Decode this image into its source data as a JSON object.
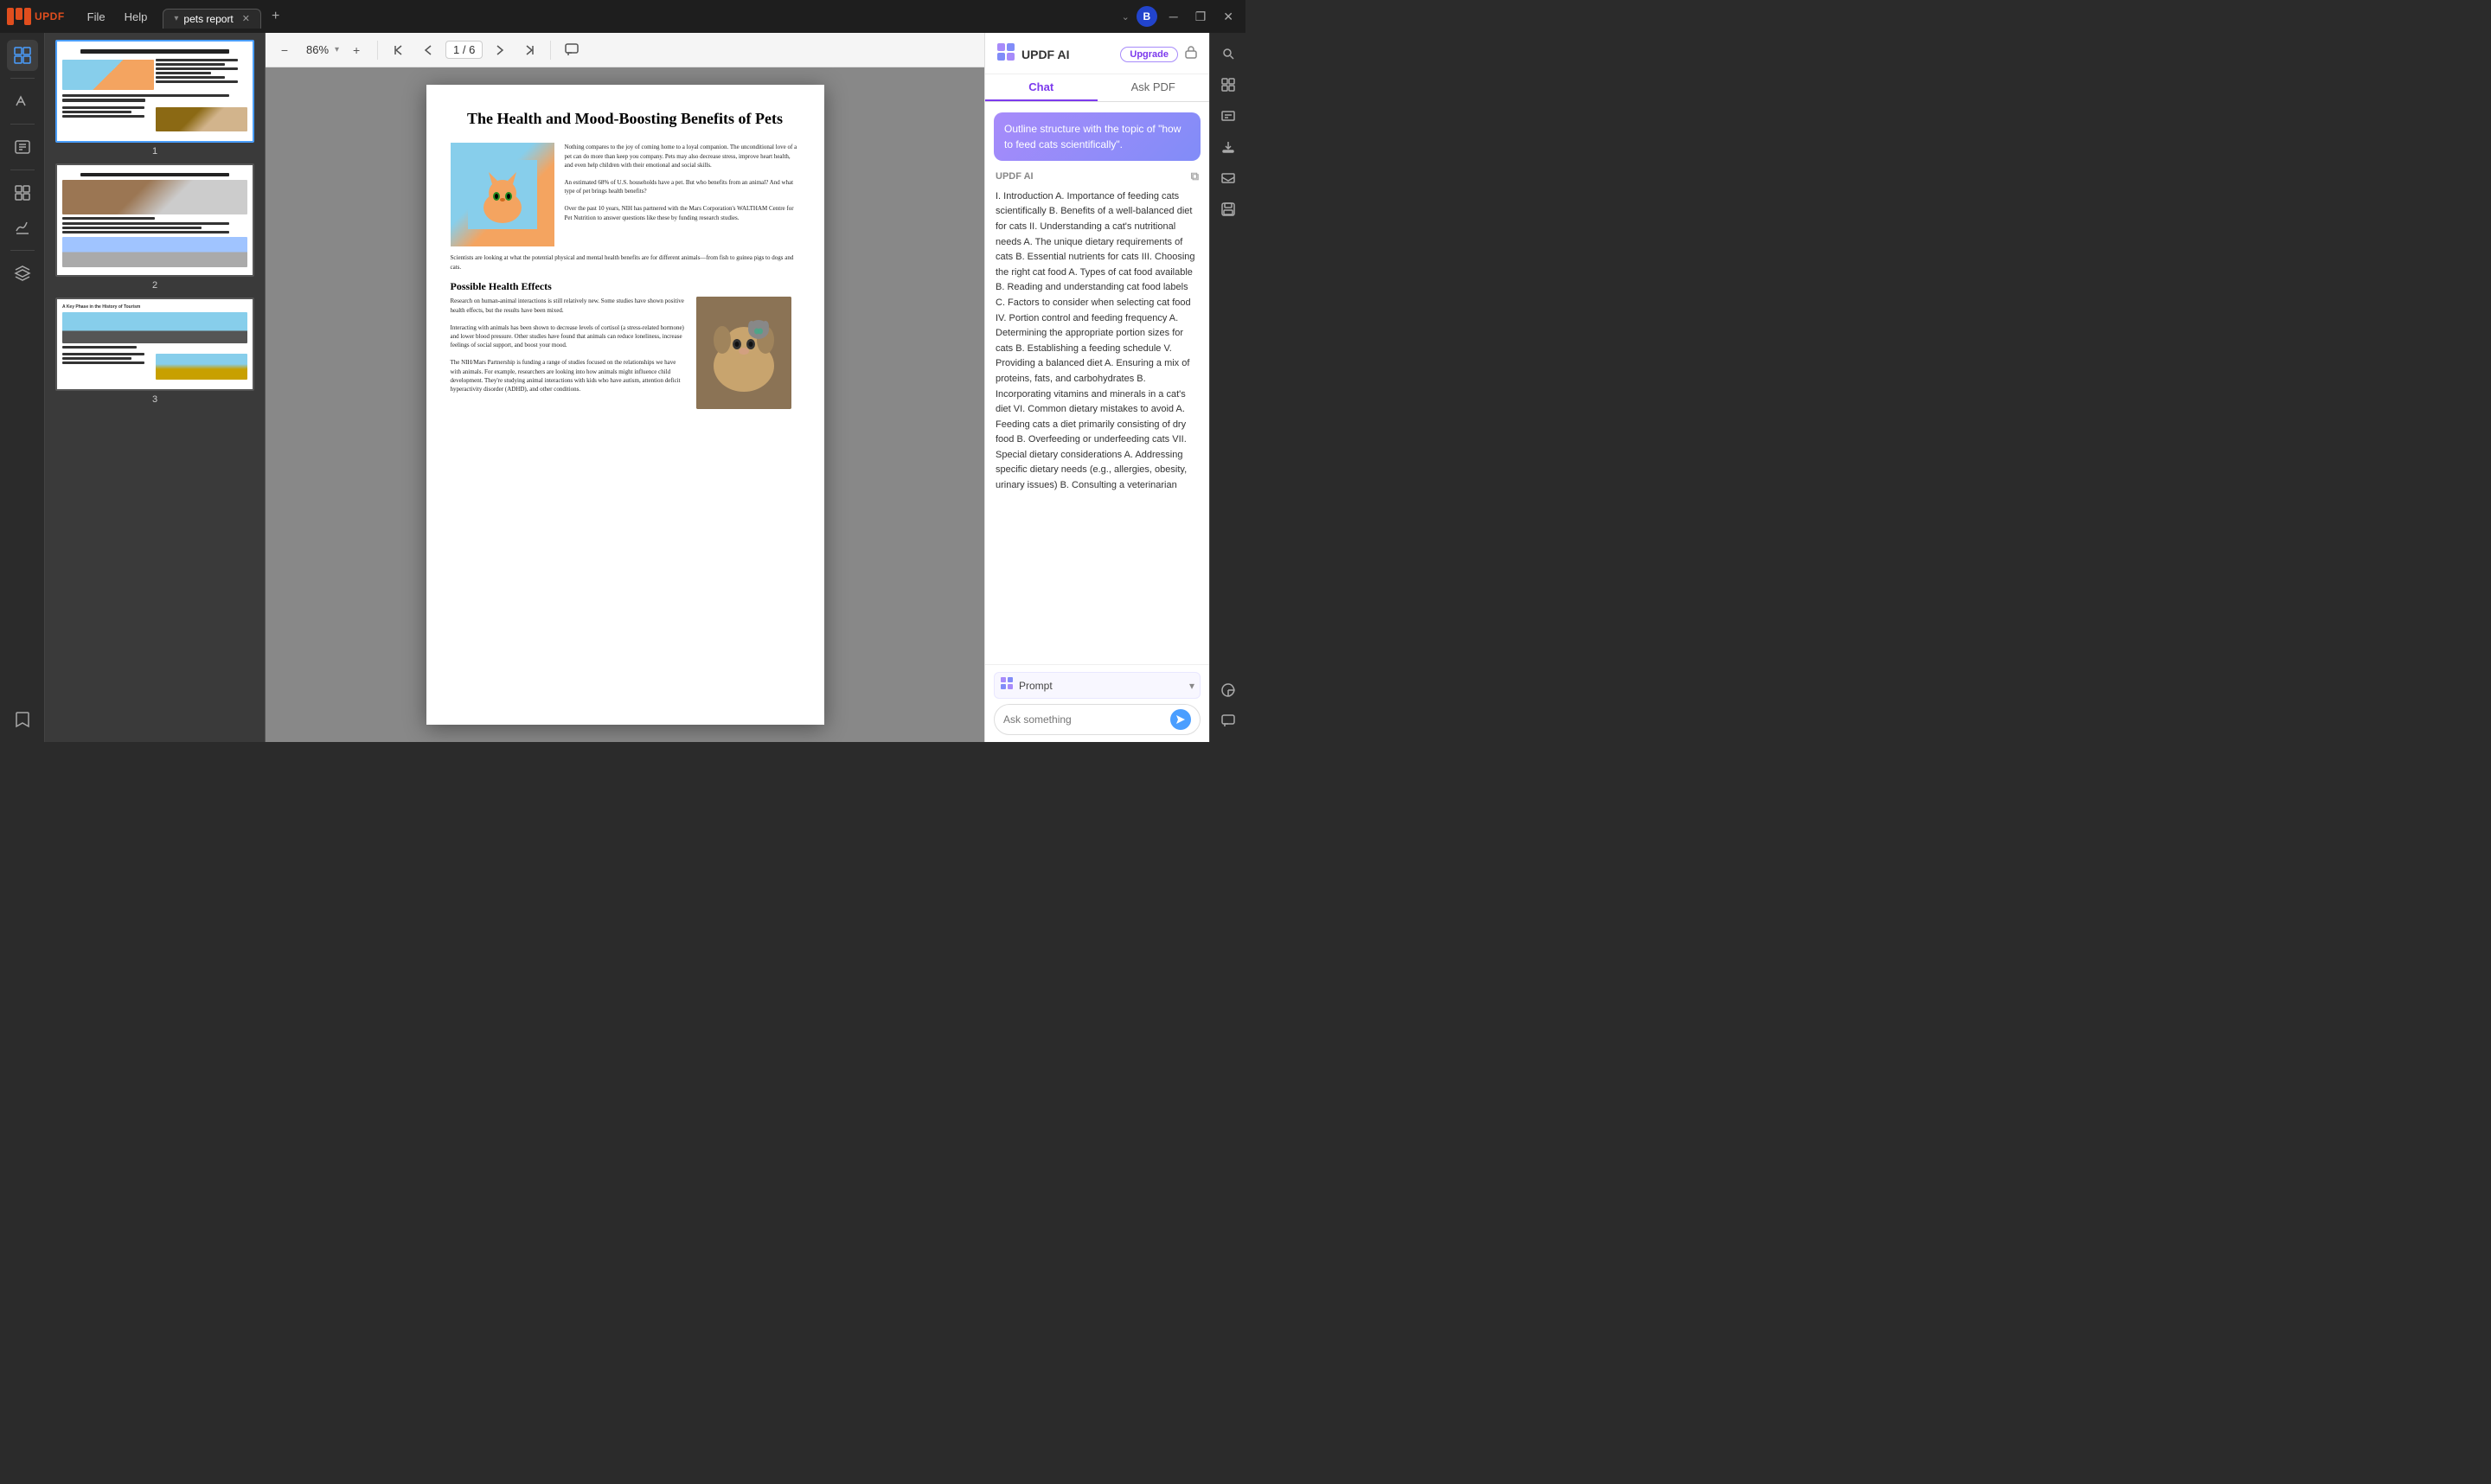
{
  "titleBar": {
    "logoText": "UPDF",
    "menuItems": [
      "File",
      "Help"
    ],
    "tab": {
      "label": "pets report",
      "chevron": "▾"
    },
    "addTab": "+",
    "windowActions": {
      "chevronDown": "⌄",
      "minimize": "─",
      "maximize": "❐",
      "close": "✕"
    },
    "avatar": "B"
  },
  "toolbar": {
    "zoomOut": "−",
    "zoomLevel": "86%",
    "zoomChevron": "▾",
    "zoomIn": "+",
    "navFirst": "⏮",
    "navPrev": "▲",
    "pageDisplay": "1 / 6",
    "navNext": "▼",
    "navLast": "⏭",
    "comment": "💬"
  },
  "pdf": {
    "title": "The Health and Mood-Boosting Benefits of Pets",
    "intro": "Nothing compares to the joy of coming home to a loyal companion. The unconditional love of a pet can do more than keep you company. Pets may also decrease stress, improve heart health, and even help children with their emotional and social skills.",
    "para2": "An estimated 68% of U.S. households have a pet. But who benefits from an animal? And what type of pet brings health benefits?",
    "para3": "Over the past 10 years, NIH has partnered with the Mars Corporation's WALTHAM Centre for Pet Nutrition to answer questions like these by funding research studies.",
    "fullText": "Scientists are looking at what the potential physical and mental health benefits are for different animals—from fish to guinea pigs to dogs and cats.",
    "section1Title": "Possible Health Effects",
    "section1Para1": "Research on human-animal interactions is still relatively new. Some studies have shown positive health effects, but the results have been mixed.",
    "section1Para2": "Interacting with animals has been shown to decrease levels of cortisol (a stress-related hormone) and lower blood pressure. Other studies have found that animals can reduce loneliness, increase feelings of social support, and boost your mood.",
    "section1Para3": "The NIH/Mars Partnership is funding a range of studies focused on the relationships we have with animals. For example, researchers are looking into how animals might influence child development. They're studying animal interactions with kids who have autism, attention deficit hyperactivity disorder (ADHD), and other conditions."
  },
  "thumbnails": [
    {
      "number": "1",
      "active": true
    },
    {
      "number": "2",
      "active": false
    },
    {
      "number": "3",
      "active": false,
      "hasKeyPhase": true
    }
  ],
  "aiPanel": {
    "logoText": "UPDF AI",
    "upgradeBtn": "Upgrade",
    "tabs": [
      "Chat",
      "Ask PDF"
    ],
    "activeTab": "Chat",
    "promptBubble": "Outline structure with the topic of \"how to feed cats scientifically\".",
    "responseLabel": "UPDF AI",
    "response": "I. Introduction A. Importance of feeding cats scientifically B. Benefits of a well-balanced diet for cats II. Understanding a cat's nutritional needs A. The unique dietary requirements of cats B. Essential nutrients for cats III. Choosing the right cat food A. Types of cat food available B. Reading and understanding cat food labels C. Factors to consider when selecting cat food IV. Portion control and feeding frequency A. Determining the appropriate portion sizes for cats B. Establishing a feeding schedule V. Providing a balanced diet A. Ensuring a mix of proteins, fats, and carbohydrates B. Incorporating vitamins and minerals in a cat's diet VI. Common dietary mistakes to avoid A. Feeding cats a diet primarily consisting of dry food B. Overfeeding or underfeeding cats VII. Special dietary considerations A. Addressing specific dietary needs (e.g., allergies, obesity, urinary issues) B. Consulting a veterinarian",
    "promptSelectLabel": "Prompt",
    "inputPlaceholder": "Ask something",
    "sendIcon": "➤"
  },
  "rightSidebar": {
    "icons": [
      "🔍",
      "⊞",
      "📄",
      "📤",
      "✉",
      "💾",
      "💬"
    ]
  },
  "leftSidebar": {
    "icons": [
      {
        "name": "layers-icon",
        "glyph": "⊞",
        "active": true
      },
      {
        "name": "divider1"
      },
      {
        "name": "highlight-icon",
        "glyph": "✏"
      },
      {
        "name": "divider2"
      },
      {
        "name": "edit-icon",
        "glyph": "📝"
      },
      {
        "name": "divider3"
      },
      {
        "name": "organize-icon",
        "glyph": "⊟"
      },
      {
        "name": "signature-icon",
        "glyph": "✒"
      },
      {
        "name": "divider4"
      },
      {
        "name": "stamp-icon",
        "glyph": "🔖"
      },
      {
        "name": "bookmark-icon",
        "glyph": "🔖"
      }
    ]
  }
}
